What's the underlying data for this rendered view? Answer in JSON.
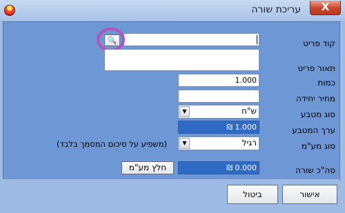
{
  "window": {
    "title": "עריכת שורה",
    "close_label": "X"
  },
  "fields": {
    "item_code_label": "קוד פריט",
    "item_code_value": "",
    "item_desc_label": "תאור פריט",
    "item_desc_value": "",
    "quantity_label": "כמות",
    "quantity_value": "1.000",
    "unit_price_label": "מחיר יחידה",
    "unit_price_value": "",
    "currency_type_label": "סוג מטבע",
    "currency_type_value": "ש\"ח",
    "currency_value_label": "ערך המטבע",
    "currency_value_value": "₪ 1.000",
    "vat_type_label": "סוג מע\"מ",
    "vat_type_value": "רגיל",
    "vat_note": "(משפיע על סיכום המסמך בלבד)",
    "line_total_label": "סה\"כ שורה",
    "line_total_value": "₪ 0.000"
  },
  "buttons": {
    "extract_vat": "חלץ מע\"מ",
    "ok": "אישור",
    "cancel": "ביטול"
  },
  "icons": {
    "lookup": "binoculars-icon",
    "app": "app-logo-icon",
    "dropdown": "chevron-down-icon"
  },
  "colors": {
    "panel": "#6d97d5",
    "readonly_field": "#2f6bc4",
    "highlight_ring": "#b551ba",
    "close_button": "#c8442a"
  }
}
